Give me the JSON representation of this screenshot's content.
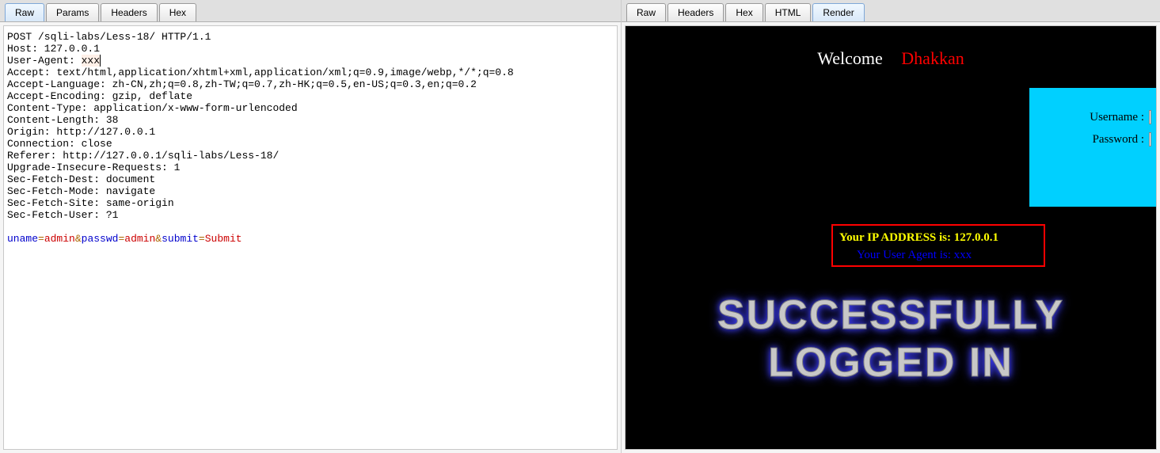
{
  "left_tabs": [
    "Raw",
    "Params",
    "Headers",
    "Hex"
  ],
  "left_active_tab": "Raw",
  "right_tabs": [
    "Raw",
    "Headers",
    "Hex",
    "HTML",
    "Render"
  ],
  "right_active_tab": "Render",
  "request": {
    "line01": "POST /sqli-labs/Less-18/ HTTP/1.1",
    "line02": "Host: 127.0.0.1",
    "line03a": "User-Agent: ",
    "line03b": "xxx",
    "line04": "Accept: text/html,application/xhtml+xml,application/xml;q=0.9,image/webp,*/*;q=0.8",
    "line05": "Accept-Language: zh-CN,zh;q=0.8,zh-TW;q=0.7,zh-HK;q=0.5,en-US;q=0.3,en;q=0.2",
    "line06": "Accept-Encoding: gzip, deflate",
    "line07": "Content-Type: application/x-www-form-urlencoded",
    "line08": "Content-Length: 38",
    "line09": "Origin: http://127.0.0.1",
    "line10": "Connection: close",
    "line11": "Referer: http://127.0.0.1/sqli-labs/Less-18/",
    "line12": "Upgrade-Insecure-Requests: 1",
    "line13": "Sec-Fetch-Dest: document",
    "line14": "Sec-Fetch-Mode: navigate",
    "line15": "Sec-Fetch-Site: same-origin",
    "line16": "Sec-Fetch-User: ?1"
  },
  "body": {
    "p1_name": "uname",
    "p1_val": "admin",
    "p2_name": "passwd",
    "p2_val": "admin",
    "p3_name": "submit",
    "p3_val": "Submit",
    "amp": "&",
    "eq": "="
  },
  "render": {
    "welcome": "Welcome",
    "dhakkan": "Dhakkan",
    "username_label": "Username :",
    "password_label": "Password :",
    "ip_line": "Your IP ADDRESS is: 127.0.0.1",
    "ua_line": "Your User Agent is: xxx",
    "success1": "SUCCESSFULLY",
    "success2": "LOGGED IN"
  }
}
